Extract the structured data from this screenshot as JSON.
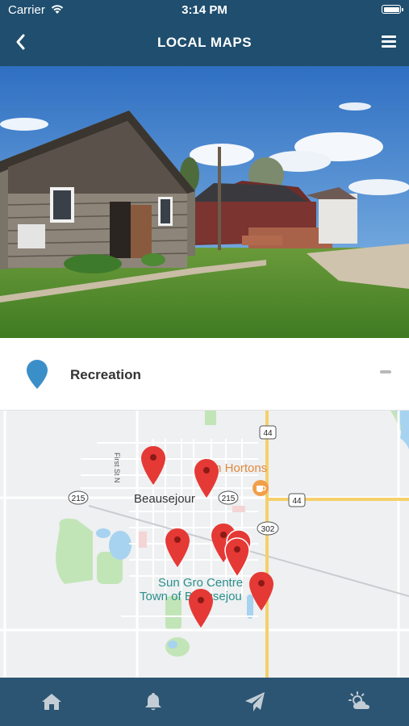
{
  "status": {
    "carrier": "Carrier",
    "time": "3:14 PM",
    "icons": [
      "wifi-icon",
      "battery-icon"
    ]
  },
  "header": {
    "title": "LOCAL MAPS",
    "back_icon": "chevron-left-icon",
    "menu_icon": "hamburger-menu-icon"
  },
  "category": {
    "label": "Recreation",
    "pin_color": "#3b8fc9",
    "collapse_icon": "minus-icon"
  },
  "map": {
    "town_label": "Beausejour",
    "street_label": "First St N",
    "poi_label": "m Hortons",
    "poi_icon": "coffee-icon",
    "center_label_line1": "Sun Gro Centre",
    "center_label_line2": "Town of Beausejou",
    "highway_shields": [
      "44",
      "215",
      "215",
      "44",
      "302"
    ],
    "marker_color": "#e53935",
    "marker_icon": "map-pin-icon"
  },
  "tabs": [
    {
      "name": "home",
      "icon": "home-icon"
    },
    {
      "name": "notifications",
      "icon": "bell-icon"
    },
    {
      "name": "send",
      "icon": "paper-plane-icon"
    },
    {
      "name": "weather",
      "icon": "weather-icon"
    }
  ],
  "colors": {
    "header_bg": "#1f4e6e",
    "tab_bar_bg": "#2c5573",
    "highway": "#f5d06b",
    "water": "#a7d3f0",
    "park": "#c2e5b8"
  }
}
